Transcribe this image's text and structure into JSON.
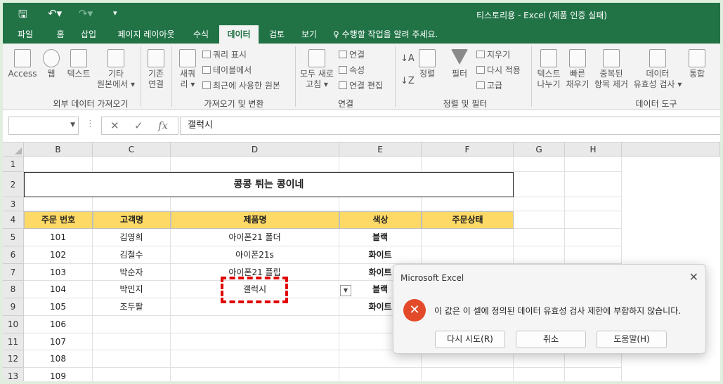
{
  "window": {
    "title": "티스토리용 - Excel (제품 인증 실패)"
  },
  "quick_access": {
    "save_icon": "save-icon",
    "undo_icon": "undo-icon",
    "redo_icon": "redo-icon"
  },
  "tabs": [
    {
      "label": "파일"
    },
    {
      "label": "홈"
    },
    {
      "label": "삽입"
    },
    {
      "label": "페이지 레이아웃"
    },
    {
      "label": "수식"
    },
    {
      "label": "데이터"
    },
    {
      "label": "검토"
    },
    {
      "label": "보기"
    }
  ],
  "tell_me": "수행할 작업을 알려 주세요.",
  "ribbon": {
    "access": "Access",
    "web": "웹",
    "text": "텍스트",
    "other_1": "기타",
    "other_2": "원본에서 ▾",
    "existing_1": "기존",
    "existing_2": "연결",
    "refresh_query_1": "새쿼",
    "refresh_query_2": "리 ▾",
    "show_query": "쿼리 표시",
    "from_table": "테이블에서",
    "recent_sources": "최근에 사용한 원본",
    "refresh_all_1": "모두 새로",
    "refresh_all_2": "고침 ▾",
    "connections": "연결",
    "properties": "속성",
    "edit_links": "연결 편집",
    "sort": "정렬",
    "filter": "필터",
    "clear": "지우기",
    "reapply": "다시 적용",
    "advanced": "고급",
    "text_to_cols_1": "텍스트",
    "text_to_cols_2": "나누기",
    "flash_fill_1": "빠른",
    "flash_fill_2": "채우기",
    "remove_dup_1": "중복된",
    "remove_dup_2": "항목 제거",
    "validation_1": "데이터",
    "validation_2": "유효성 검사 ▾",
    "consolidate": "통합",
    "group_labels": [
      "외부 데이터 가져오기",
      "가져오기 및 변환",
      "연결",
      "정렬 및 필터",
      "데이터 도구"
    ]
  },
  "formula_bar": {
    "value": "갤럭시",
    "cancel": "✕",
    "enter": "✓",
    "fx": "fx"
  },
  "columns": [
    "B",
    "C",
    "D",
    "E",
    "F",
    "G",
    "H"
  ],
  "rows": [
    "1",
    "2",
    "3",
    "4",
    "5",
    "6",
    "7",
    "8",
    "9",
    "10",
    "11",
    "12",
    "13"
  ],
  "sheet": {
    "title": "콩콩 튀는 콩이네",
    "headers": [
      "주문 번호",
      "고객명",
      "제품명",
      "색상",
      "주문상태"
    ],
    "data": [
      [
        "101",
        "김영희",
        "아이폰21 폴더",
        "블랙",
        ""
      ],
      [
        "102",
        "김철수",
        "아이폰21s",
        "화이트",
        ""
      ],
      [
        "103",
        "박순자",
        "아이폰21 플립",
        "화이트",
        ""
      ],
      [
        "104",
        "박민지",
        "갤럭시",
        "블랙",
        ""
      ],
      [
        "105",
        "조두팔",
        "",
        "화이트",
        ""
      ],
      [
        "106",
        "",
        "",
        "",
        ""
      ],
      [
        "107",
        "",
        "",
        "",
        ""
      ],
      [
        "108",
        "",
        "",
        "",
        ""
      ],
      [
        "109",
        "",
        "",
        "",
        ""
      ]
    ]
  },
  "dialog": {
    "title": "Microsoft Excel",
    "message": "이 값은 이 셀에 정의된 데이터 유효성 검사 제한에 부합하지 않습니다.",
    "retry": "다시 시도(R)",
    "cancel": "취소",
    "help": "도움말(H)",
    "close": "✕",
    "icon": "error-icon"
  }
}
